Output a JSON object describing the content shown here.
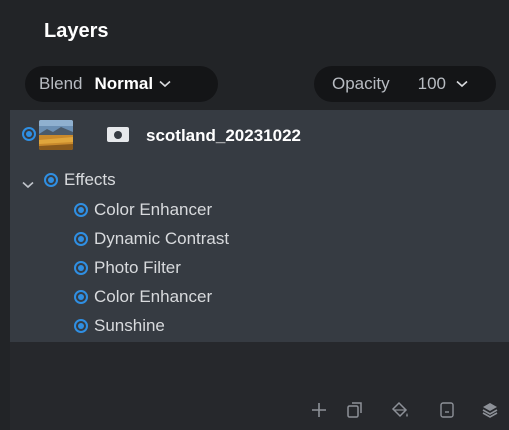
{
  "panel": {
    "title": "Layers"
  },
  "blend": {
    "label": "Blend",
    "value": "Normal"
  },
  "opacity": {
    "label": "Opacity",
    "value": "100"
  },
  "layer": {
    "name": "scotland_20231022"
  },
  "effects": {
    "label": "Effects",
    "items": [
      {
        "label": "Color Enhancer"
      },
      {
        "label": "Dynamic Contrast"
      },
      {
        "label": "Photo Filter"
      },
      {
        "label": "Color Enhancer"
      },
      {
        "label": "Sunshine"
      }
    ]
  },
  "toolbar": {
    "icons": [
      "add-icon",
      "duplicate-icon",
      "fill-icon",
      "mask-icon",
      "layers-icon"
    ]
  },
  "colors": {
    "accent": "#2f8fe3",
    "panel_bg": "#363b42",
    "app_bg": "#222427"
  }
}
